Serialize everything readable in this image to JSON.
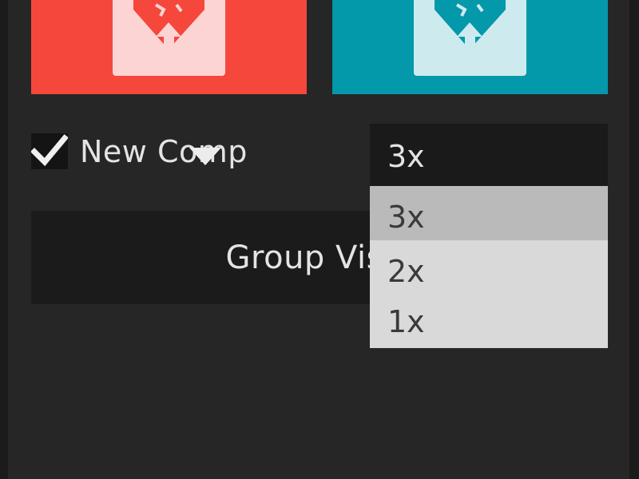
{
  "tiles": [
    {
      "name": "red-export-tile",
      "color": "#f5473c",
      "doc_color": "#fcd4d3",
      "icon": "gem-upload-icon"
    },
    {
      "name": "teal-export-tile",
      "color": "#0398aa",
      "doc_color": "#cdebee",
      "icon": "gem-upload-icon"
    }
  ],
  "new_comp": {
    "label": "New Comp",
    "checked": true
  },
  "scale_select": {
    "value": "3x",
    "options": [
      {
        "label": "3x",
        "selected": true
      },
      {
        "label": "2x",
        "selected": false
      },
      {
        "label": "1x",
        "selected": false
      }
    ]
  },
  "group_button": {
    "label": "Group Visib"
  }
}
